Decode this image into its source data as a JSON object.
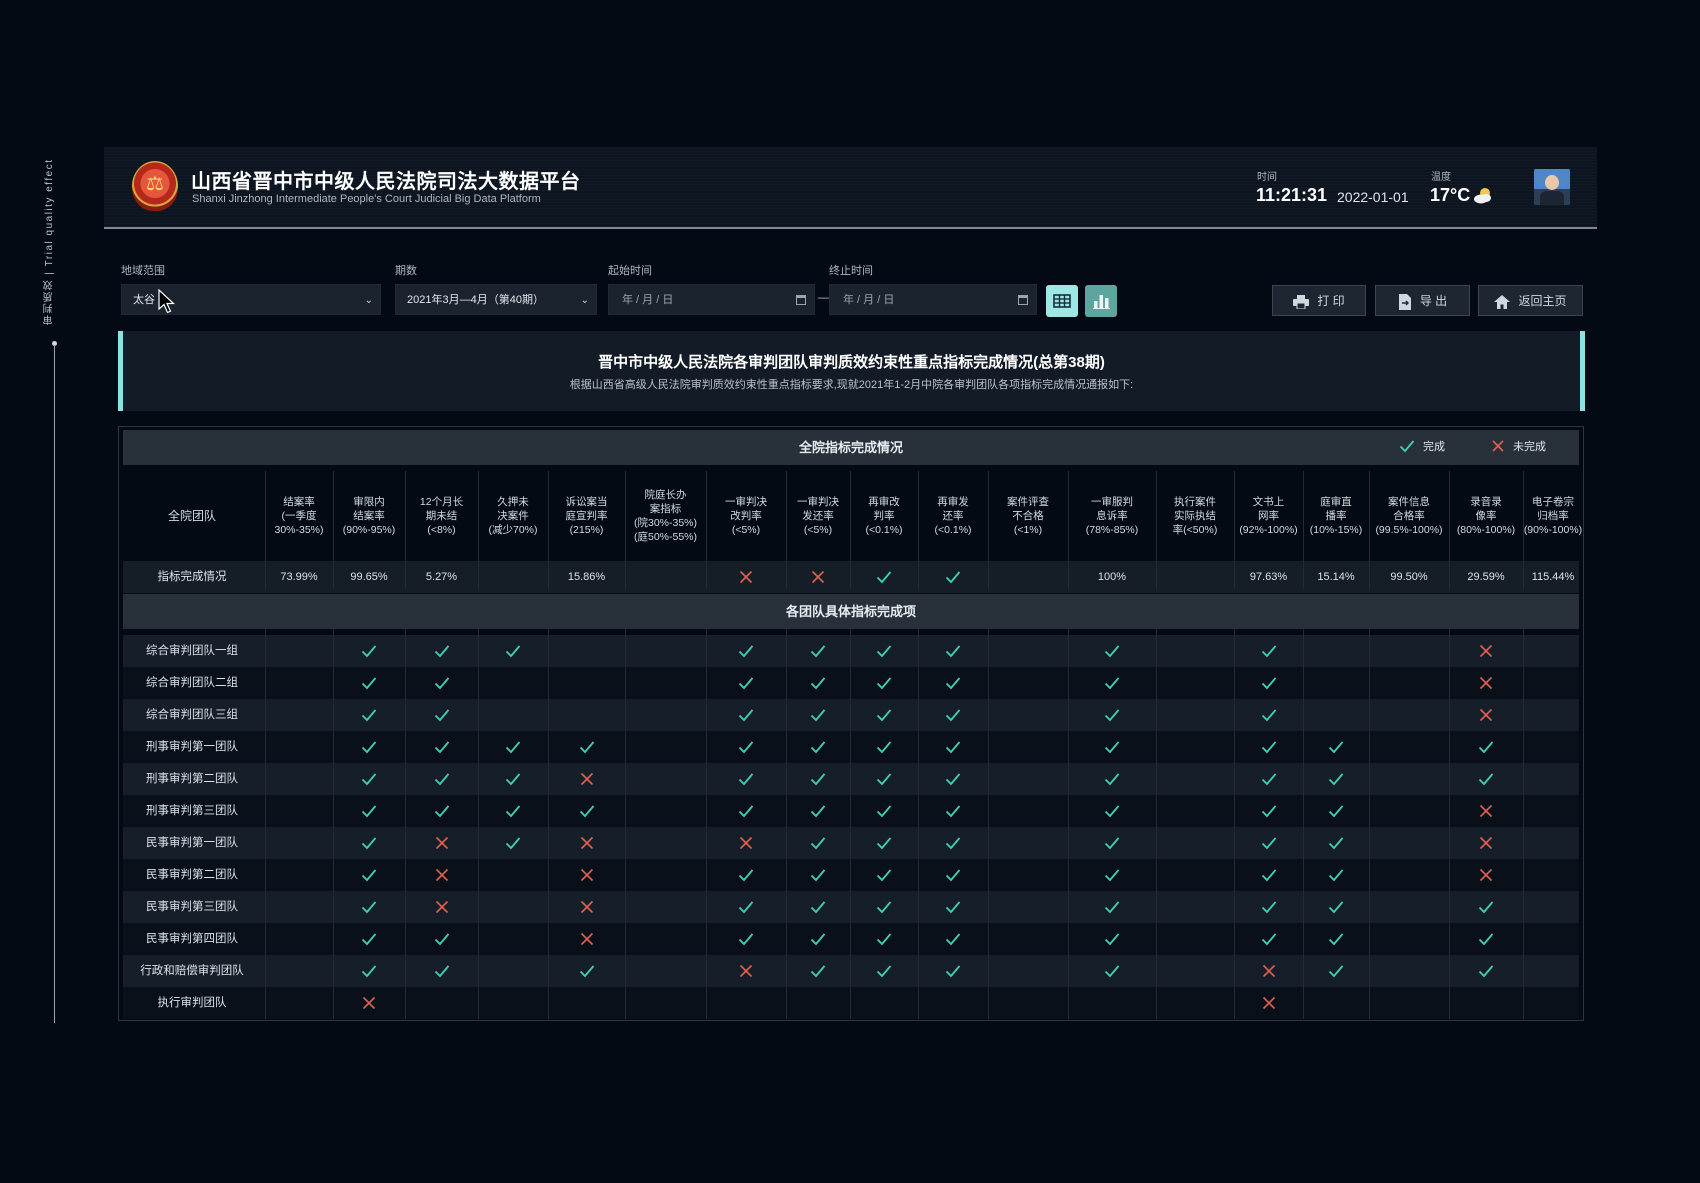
{
  "side_label": "审判质效 | Trial quality effect",
  "header": {
    "title": "山西省晋中市中级人民法院司法大数据平台",
    "subtitle": "Shanxi Jinzhong Intermediate People's Court Judicial Big Data Platform",
    "time_label": "时间",
    "time": "11:21:31",
    "date": "2022-01-01",
    "temp_label": "温度",
    "temp": "17°C",
    "weather_icon": "sun-cloud-icon"
  },
  "filters": {
    "region_label": "地域范围",
    "region_value": "太谷",
    "period_label": "期数",
    "period_value": "2021年3月—4月（第40期）",
    "start_label": "起始时间",
    "start_placeholder": "年 / 月 / 日",
    "end_label": "终止时间",
    "end_placeholder": "年 / 月 / 日",
    "dash": "—"
  },
  "actions": {
    "print": "打  印",
    "export": "导  出",
    "home": "返回主页"
  },
  "banner": {
    "title": "晋中市中级人民法院各审判团队审判质效约束性重点指标完成情况(总第38期)",
    "desc": "根据山西省高级人民法院审判质效约束性重点指标要求,现就2021年1-2月中院各审判团队各项指标完成情况通报如下:"
  },
  "colors": {
    "check": "#3fd1b4",
    "cross": "#e0614f",
    "accent": "#8fe0e0"
  },
  "table": {
    "section1": "全院指标完成情况",
    "legend_done": "完成",
    "legend_undone": "未完成",
    "section2": "各团队具体指标完成项",
    "first_header": "全院团队",
    "headers": [
      "结案率\n(一季度\n30%-35%)",
      "审限内\n结案率\n(90%-95%)",
      "12个月长\n期未结\n(<8%)",
      "久押未\n决案件\n(减少70%)",
      "诉讼案当\n庭宣判率\n(215%)",
      "院庭长办\n案指标\n(院30%-35%)\n(庭50%-55%)",
      "一审判决\n改判率\n(<5%)",
      "一审判决\n发还率\n(<5%)",
      "再审改\n判率\n(<0.1%)",
      "再审发\n还率\n(<0.1%)",
      "案件评查\n不合格\n(<1%)",
      "一审服判\n息诉率\n(78%-85%)",
      "执行案件\n实际执结\n率(<50%)",
      "文书上\n网率\n(92%-100%)",
      "庭审直\n播率\n(10%-15%)",
      "案件信息\n合格率\n(99.5%-100%)",
      "录音录\n像率\n(80%-100%)",
      "电子卷宗\n归档率\n(90%-100%)"
    ],
    "summary_label": "指标完成情况",
    "summary": [
      "73.99%",
      "99.65%",
      "5.27%",
      "",
      "15.86%",
      "",
      "x",
      "x",
      "v",
      "v",
      "",
      "100%",
      "",
      "97.63%",
      "15.14%",
      "99.50%",
      "29.59%",
      "115.44%"
    ],
    "teams": [
      {
        "name": "综合审判团队一组",
        "marks": [
          "",
          "v",
          "v",
          "v",
          "",
          "",
          "v",
          "v",
          "v",
          "v",
          "",
          "v",
          "",
          "v",
          "",
          "",
          "x",
          ""
        ]
      },
      {
        "name": "综合审判团队二组",
        "marks": [
          "",
          "v",
          "v",
          "",
          "",
          "",
          "v",
          "v",
          "v",
          "v",
          "",
          "v",
          "",
          "v",
          "",
          "",
          "x",
          ""
        ]
      },
      {
        "name": "综合审判团队三组",
        "marks": [
          "",
          "v",
          "v",
          "",
          "",
          "",
          "v",
          "v",
          "v",
          "v",
          "",
          "v",
          "",
          "v",
          "",
          "",
          "x",
          ""
        ]
      },
      {
        "name": "刑事审判第一团队",
        "marks": [
          "",
          "v",
          "v",
          "v",
          "v",
          "",
          "v",
          "v",
          "v",
          "v",
          "",
          "v",
          "",
          "v",
          "v",
          "",
          "v",
          ""
        ]
      },
      {
        "name": "刑事审判第二团队",
        "marks": [
          "",
          "v",
          "v",
          "v",
          "x",
          "",
          "v",
          "v",
          "v",
          "v",
          "",
          "v",
          "",
          "v",
          "v",
          "",
          "v",
          ""
        ]
      },
      {
        "name": "刑事审判第三团队",
        "marks": [
          "",
          "v",
          "v",
          "v",
          "v",
          "",
          "v",
          "v",
          "v",
          "v",
          "",
          "v",
          "",
          "v",
          "v",
          "",
          "x",
          ""
        ]
      },
      {
        "name": "民事审判第一团队",
        "marks": [
          "",
          "v",
          "x",
          "v",
          "x",
          "",
          "x",
          "v",
          "v",
          "v",
          "",
          "v",
          "",
          "v",
          "v",
          "",
          "x",
          ""
        ]
      },
      {
        "name": "民事审判第二团队",
        "marks": [
          "",
          "v",
          "x",
          "",
          "x",
          "",
          "v",
          "v",
          "v",
          "v",
          "",
          "v",
          "",
          "v",
          "v",
          "",
          "x",
          ""
        ]
      },
      {
        "name": "民事审判第三团队",
        "marks": [
          "",
          "v",
          "x",
          "",
          "x",
          "",
          "v",
          "v",
          "v",
          "v",
          "",
          "v",
          "",
          "v",
          "v",
          "",
          "v",
          ""
        ]
      },
      {
        "name": "民事审判第四团队",
        "marks": [
          "",
          "v",
          "v",
          "",
          "x",
          "",
          "v",
          "v",
          "v",
          "v",
          "",
          "v",
          "",
          "v",
          "v",
          "",
          "v",
          ""
        ]
      },
      {
        "name": "行政和赔偿审判团队",
        "marks": [
          "",
          "v",
          "v",
          "",
          "v",
          "",
          "x",
          "v",
          "v",
          "v",
          "",
          "v",
          "",
          "x",
          "v",
          "",
          "v",
          ""
        ]
      },
      {
        "name": "执行审判团队",
        "marks": [
          "",
          "x",
          "",
          "",
          "",
          "",
          "",
          "",
          "",
          "",
          "",
          "",
          "",
          "x",
          "",
          "",
          "",
          ""
        ]
      }
    ]
  }
}
